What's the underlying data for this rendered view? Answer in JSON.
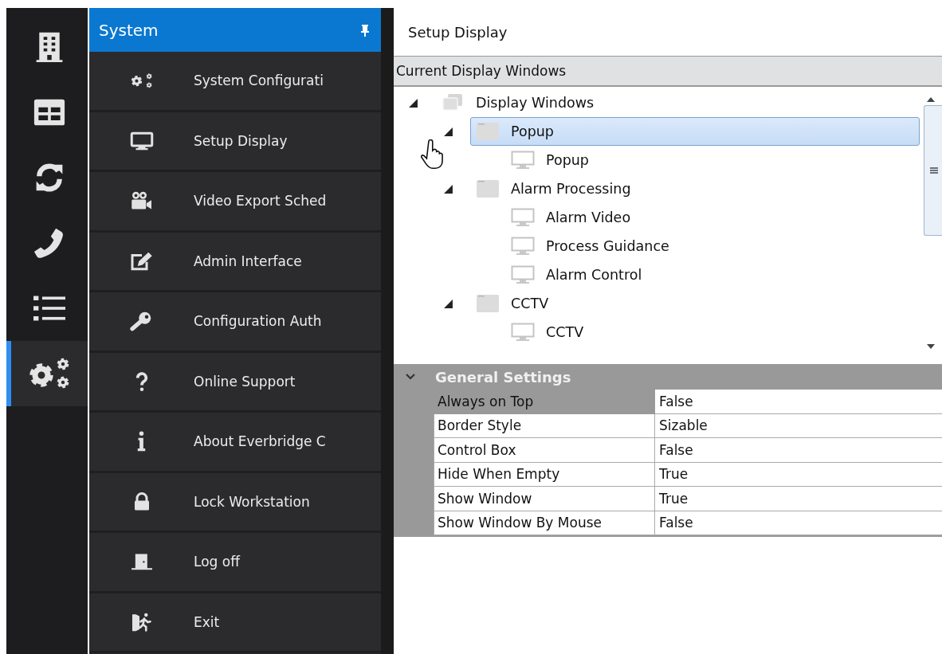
{
  "rail": [
    {
      "selected": false
    },
    {
      "selected": false
    },
    {
      "selected": false
    },
    {
      "selected": false
    },
    {
      "selected": false
    },
    {
      "selected": true
    }
  ],
  "menu": {
    "title": "System",
    "items": [
      {
        "label": "System Configurati"
      },
      {
        "label": "Setup Display"
      },
      {
        "label": "Video Export Sched"
      },
      {
        "label": "Admin Interface"
      },
      {
        "label": "Configuration Auth"
      },
      {
        "label": "Online Support"
      },
      {
        "label": "About Everbridge C"
      },
      {
        "label": "Lock Workstation"
      },
      {
        "label": "Log off"
      },
      {
        "label": "Exit"
      }
    ]
  },
  "panel": {
    "title": "Setup Display",
    "tree": {
      "header": "Current Display Windows",
      "nodes": [
        {
          "label": "Display Windows",
          "kind": "root",
          "expanded": true,
          "selected": false,
          "children": [
            {
              "label": "Popup",
              "kind": "group",
              "expanded": true,
              "selected": true,
              "children": [
                {
                  "label": "Popup",
                  "kind": "display",
                  "selected": false
                }
              ]
            },
            {
              "label": "Alarm Processing",
              "kind": "group",
              "expanded": true,
              "selected": false,
              "children": [
                {
                  "label": "Alarm Video",
                  "kind": "display",
                  "selected": false
                },
                {
                  "label": "Process Guidance",
                  "kind": "display",
                  "selected": false
                },
                {
                  "label": "Alarm Control",
                  "kind": "display",
                  "selected": false
                }
              ]
            },
            {
              "label": "CCTV",
              "kind": "group",
              "expanded": true,
              "selected": false,
              "children": [
                {
                  "label": "CCTV",
                  "kind": "display",
                  "selected": false
                }
              ]
            }
          ]
        }
      ]
    },
    "properties": {
      "group": "General Settings",
      "expanded": true,
      "rows": [
        {
          "label": "Always on Top",
          "value": "False",
          "selected": true
        },
        {
          "label": "Border Style",
          "value": "Sizable",
          "selected": false
        },
        {
          "label": "Control Box",
          "value": "False",
          "selected": false
        },
        {
          "label": "Hide When Empty",
          "value": "True",
          "selected": false
        },
        {
          "label": "Show Window",
          "value": "True",
          "selected": false
        },
        {
          "label": "Show Window By Mouse",
          "value": "False",
          "selected": false
        }
      ]
    }
  }
}
